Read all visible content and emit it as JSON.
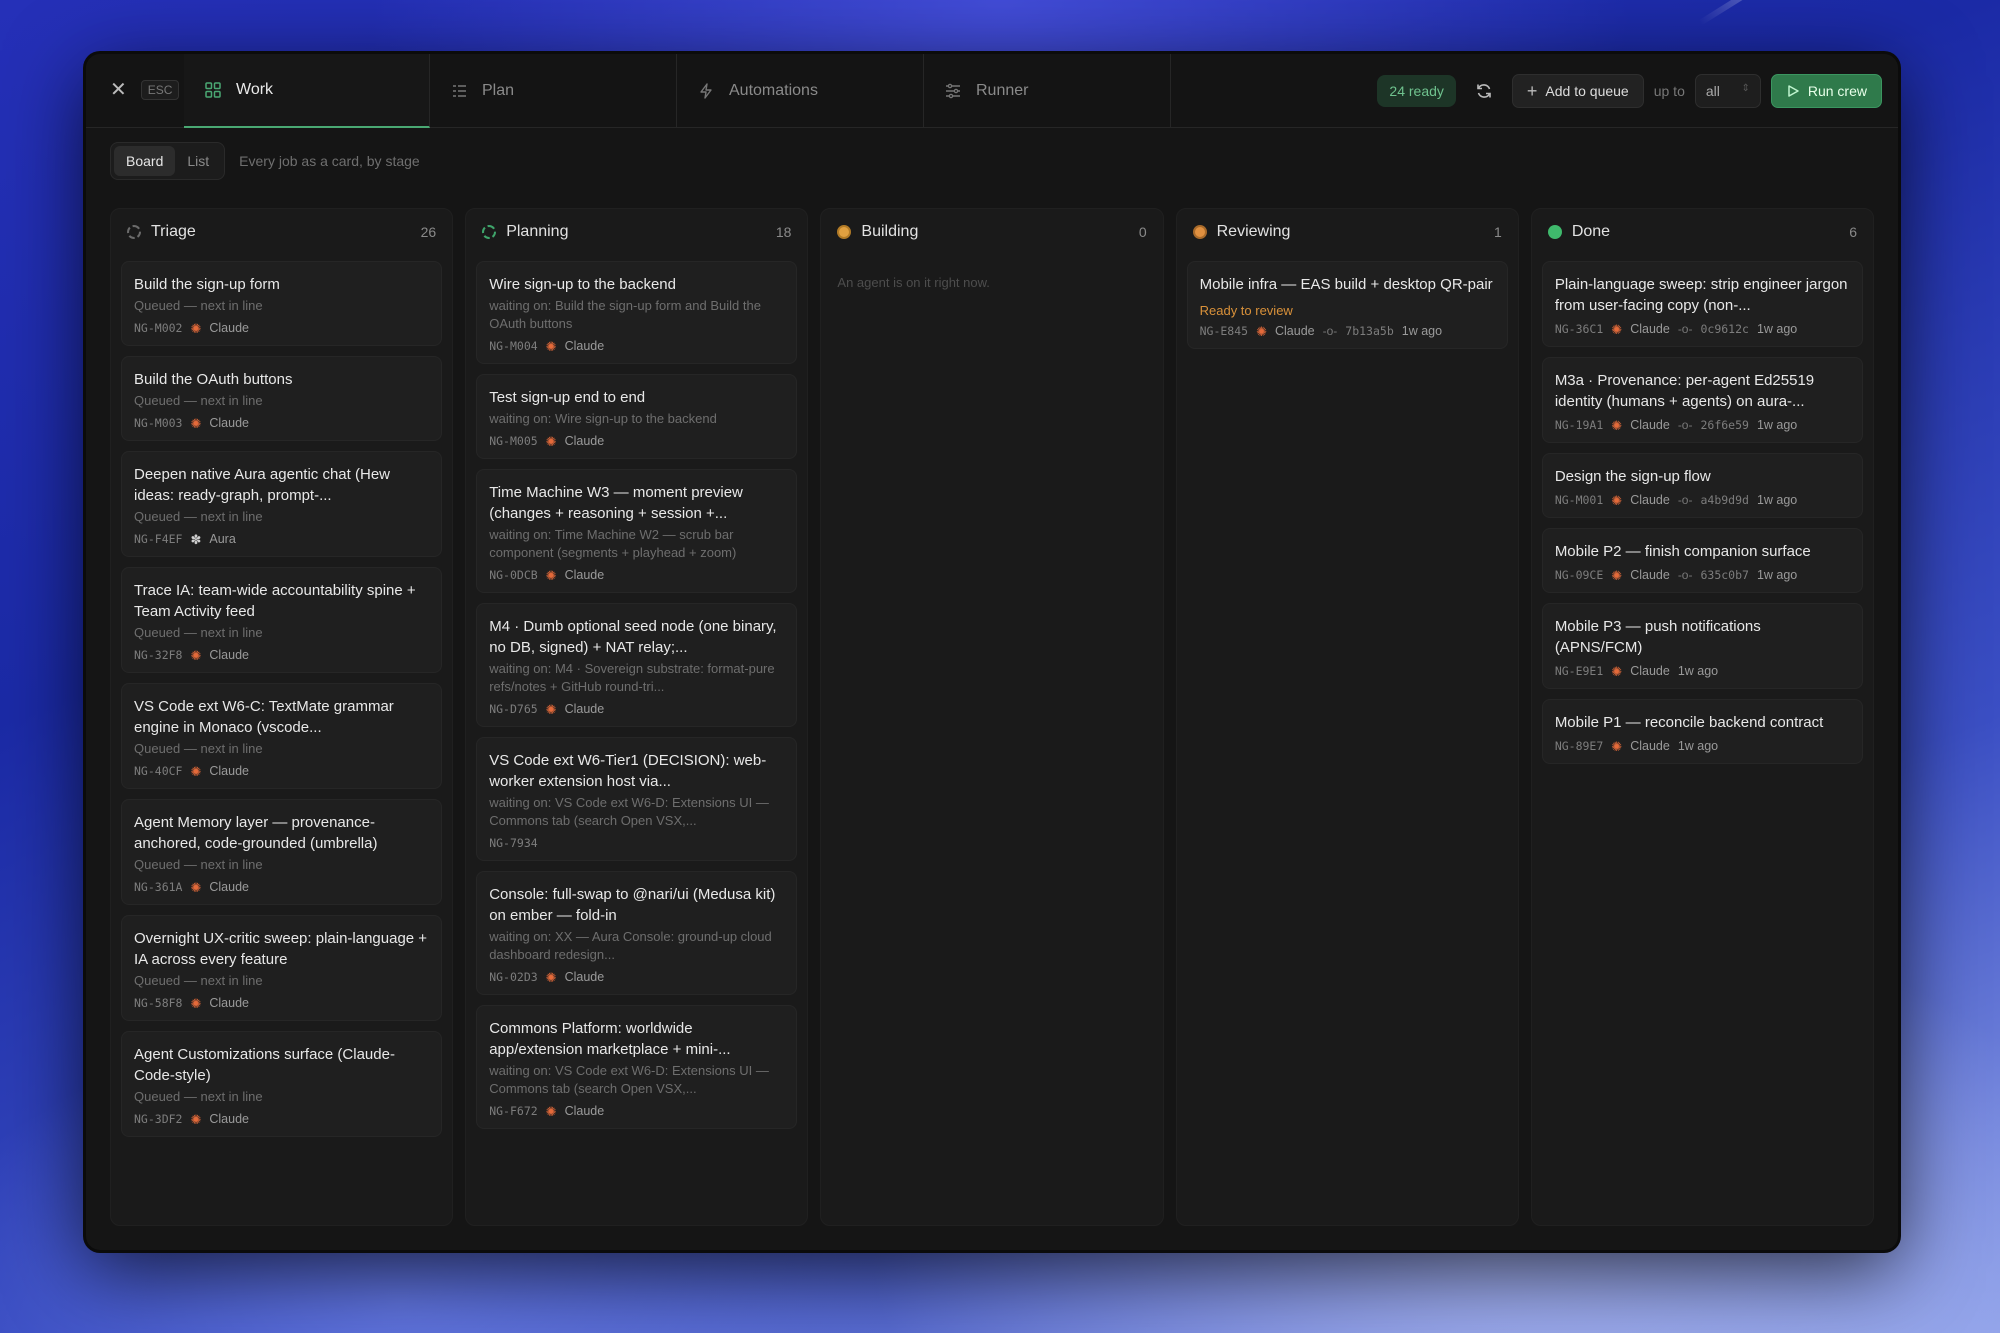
{
  "topbar": {
    "esc_label": "ESC",
    "tabs": [
      {
        "label": "Work"
      },
      {
        "label": "Plan"
      },
      {
        "label": "Automations"
      },
      {
        "label": "Runner"
      }
    ],
    "ready_label": "24 ready",
    "add_queue_label": "Add to queue",
    "upto_label": "up to",
    "upto_value": "all",
    "run_crew_label": "Run crew"
  },
  "subbar": {
    "board_label": "Board",
    "list_label": "List",
    "subtitle": "Every job as a card, by stage"
  },
  "columns": [
    {
      "title": "Triage",
      "count": "26",
      "cards": [
        {
          "title": "Build the sign-up form",
          "sub": "Queued — next in line",
          "id": "NG-M002",
          "agent": "Claude"
        },
        {
          "title": "Build the OAuth buttons",
          "sub": "Queued — next in line",
          "id": "NG-M003",
          "agent": "Claude"
        },
        {
          "title": "Deepen native Aura agentic chat (Hew ideas: ready-graph, prompt-...",
          "sub": "Queued — next in line",
          "id": "NG-F4EF",
          "agent": "Aura"
        },
        {
          "title": "Trace IA: team-wide accountability spine + Team Activity feed",
          "sub": "Queued — next in line",
          "id": "NG-32F8",
          "agent": "Claude"
        },
        {
          "title": "VS Code ext W6-C: TextMate grammar engine in Monaco (vscode...",
          "sub": "Queued — next in line",
          "id": "NG-40CF",
          "agent": "Claude"
        },
        {
          "title": "Agent Memory layer — provenance-anchored, code-grounded (umbrella)",
          "sub": "Queued — next in line",
          "id": "NG-361A",
          "agent": "Claude"
        },
        {
          "title": "Overnight UX-critic sweep: plain-language + IA across every feature",
          "sub": "Queued — next in line",
          "id": "NG-58F8",
          "agent": "Claude"
        },
        {
          "title": "Agent Customizations surface (Claude-Code-style)",
          "sub": "Queued — next in line",
          "id": "NG-3DF2",
          "agent": "Claude"
        }
      ]
    },
    {
      "title": "Planning",
      "count": "18",
      "cards": [
        {
          "title": "Wire sign-up to the backend",
          "sub": "waiting on: Build the sign-up form and Build the OAuth buttons",
          "id": "NG-M004",
          "agent": "Claude"
        },
        {
          "title": "Test sign-up end to end",
          "sub": "waiting on: Wire sign-up to the backend",
          "id": "NG-M005",
          "agent": "Claude"
        },
        {
          "title": "Time Machine W3 — moment preview (changes + reasoning + session +...",
          "sub": "waiting on: Time Machine W2 — scrub bar component (segments + playhead + zoom)",
          "id": "NG-0DCB",
          "agent": "Claude"
        },
        {
          "title": "M4 · Dumb optional seed node (one binary, no DB, signed) + NAT relay;...",
          "sub": "waiting on: M4 · Sovereign substrate: format-pure refs/notes + GitHub round-tri...",
          "id": "NG-D765",
          "agent": "Claude"
        },
        {
          "title": "VS Code ext W6-Tier1 (DECISION): web-worker extension host via...",
          "sub": "waiting on: VS Code ext W6-D: Extensions UI — Commons tab (search Open VSX,...",
          "id": "NG-7934",
          "agent": ""
        },
        {
          "title": "Console: full-swap to @nari/ui (Medusa kit) on ember — fold-in",
          "sub": "waiting on: XX — Aura Console: ground-up cloud dashboard redesign...",
          "id": "NG-02D3",
          "agent": "Claude"
        },
        {
          "title": "Commons Platform: worldwide app/extension marketplace + mini-...",
          "sub": "waiting on: VS Code ext W6-D: Extensions UI — Commons tab (search Open VSX,...",
          "id": "NG-F672",
          "agent": "Claude"
        }
      ]
    },
    {
      "title": "Building",
      "count": "0",
      "empty": "An agent is on it right now."
    },
    {
      "title": "Reviewing",
      "count": "1",
      "cards": [
        {
          "title": "Mobile infra — EAS build + desktop QR-pair",
          "status": "Ready to review",
          "id": "NG-E845",
          "agent": "Claude",
          "commit": "7b13a5b",
          "time": "1w ago"
        }
      ]
    },
    {
      "title": "Done",
      "count": "6",
      "cards": [
        {
          "title": "Plain-language sweep: strip engineer jargon from user-facing copy (non-...",
          "id": "NG-36C1",
          "agent": "Claude",
          "commit": "0c9612c",
          "time": "1w ago"
        },
        {
          "title": "M3a · Provenance: per-agent Ed25519 identity (humans + agents) on aura-...",
          "id": "NG-19A1",
          "agent": "Claude",
          "commit": "26f6e59",
          "time": "1w ago"
        },
        {
          "title": "Design the sign-up flow",
          "id": "NG-M001",
          "agent": "Claude",
          "commit": "a4b9d9d",
          "time": "1w ago"
        },
        {
          "title": "Mobile P2 — finish companion surface",
          "id": "NG-09CE",
          "agent": "Claude",
          "commit": "635c0b7",
          "time": "1w ago"
        },
        {
          "title": "Mobile P3 — push notifications (APNS/FCM)",
          "id": "NG-E9E1",
          "agent": "Claude",
          "time": "1w ago"
        },
        {
          "title": "Mobile P1 — reconcile backend contract",
          "id": "NG-89E7",
          "agent": "Claude",
          "time": "1w ago"
        }
      ]
    }
  ],
  "colors": {
    "accent": "#3fb96c",
    "review": "#d9913a",
    "agent_claude": "#e46a3a"
  }
}
